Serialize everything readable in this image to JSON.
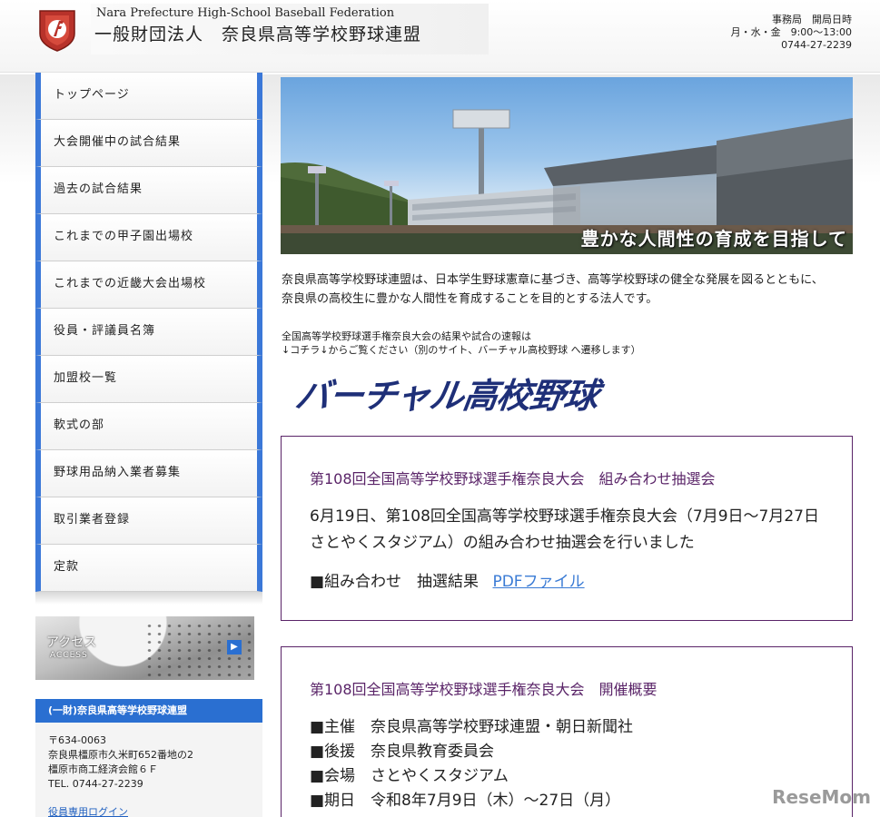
{
  "header": {
    "org_en": "Nara Prefecture High-School Baseball Federation",
    "org_ja": "一般財団法人　奈良県高等学校野球連盟",
    "office_label": "事務局　開局日時",
    "office_hours": "月・水・金　9:00〜13:00",
    "office_phone": "0744-27-2239"
  },
  "nav": {
    "items": [
      "トップページ",
      "大会開催中の試合結果",
      "過去の試合結果",
      "これまでの甲子園出場校",
      "これまでの近畿大会出場校",
      "役員・評議員名簿",
      "加盟校一覧",
      "軟式の部",
      "野球用品納入業者募集",
      "取引業者登録",
      "定款"
    ]
  },
  "access": {
    "label": "アクセス",
    "sub": "ACCESS",
    "arrow": "▶"
  },
  "info": {
    "title": "(一財)奈良県高等学校野球連盟",
    "postal": "〒634-0063",
    "address1": "奈良県橿原市久米町652番地の2",
    "address2": "橿原市商工経済会館６Ｆ",
    "tel": "TEL. 0744-27-2239",
    "login": "役員専用ログイン"
  },
  "hero": {
    "caption": "豊かな人間性の育成を目指して"
  },
  "intro": {
    "line1": "奈良県高等学校野球連盟は、日本学生野球憲章に基づき、高等学校野球の健全な発展を図るとともに、",
    "line2": "奈良県の高校生に豊かな人間性を育成することを目的とする法人です。"
  },
  "notice": {
    "line1": "全国高等学校野球選手権奈良大会の結果や試合の速報は",
    "line2": "↓コチラ↓からご覧ください（別のサイト、バーチャル高校野球 へ遷移します）"
  },
  "virtual_logo": "バーチャル高校野球",
  "news1": {
    "title": "第108回全国高等学校野球選手権奈良大会　組み合わせ抽選会",
    "body": "6月19日、第108回全国高等学校野球選手権奈良大会（7月9日〜7月27日さとやくスタジアム）の組み合わせ抽選会を行いました",
    "line": "■組み合わせ　抽選結果",
    "link": "PDFファイル"
  },
  "news2": {
    "title": "第108回全国高等学校野球選手権奈良大会　開催概要",
    "items": [
      "■主催　奈良県高等学校野球連盟・朝日新聞社",
      "■後援　奈良県教育委員会",
      "■会場　さとやくスタジアム",
      "■期日　令和8年7月9日（木）〜27日（月）"
    ]
  },
  "watermark": "ReseMom",
  "colors": {
    "nav_accent": "#3b78d8",
    "news_border": "#5a2468",
    "link": "#3a7bd5"
  }
}
